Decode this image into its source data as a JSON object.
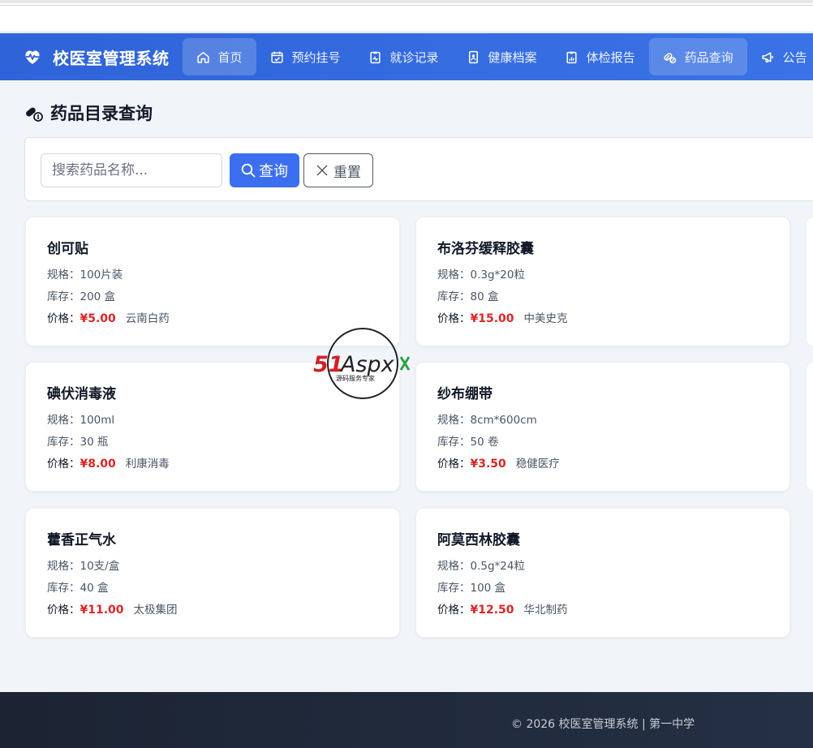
{
  "app": {
    "brand": "校医室管理系统"
  },
  "nav": {
    "items": [
      {
        "label": "首页",
        "icon": "home-icon",
        "active": true
      },
      {
        "label": "预约挂号",
        "icon": "calendar-check-icon",
        "active": false
      },
      {
        "label": "就诊记录",
        "icon": "clipboard-pulse-icon",
        "active": false
      },
      {
        "label": "健康档案",
        "icon": "file-person-icon",
        "active": false
      },
      {
        "label": "体检报告",
        "icon": "clipboard-chart-icon",
        "active": false
      },
      {
        "label": "药品查询",
        "icon": "capsule-icon",
        "active": true
      },
      {
        "label": "公告",
        "icon": "megaphone-icon",
        "active": false
      }
    ]
  },
  "page": {
    "title": "药品目录查询"
  },
  "search": {
    "placeholder": "搜索药品名称...",
    "query_label": "查询",
    "reset_label": "重置"
  },
  "labels": {
    "spec": "规格：",
    "stock": "库存：",
    "price": "价格："
  },
  "medicines": [
    {
      "name": "创可贴",
      "spec": "100片装",
      "stock": "200 盒",
      "price": "¥5.00",
      "maker": "云南白药"
    },
    {
      "name": "布洛芬缓释胶囊",
      "spec": "0.3g*20粒",
      "stock": "80 盒",
      "price": "¥15.00",
      "maker": "中美史克"
    },
    {
      "name": "碘伏消毒液",
      "spec": "100ml",
      "stock": "30 瓶",
      "price": "¥8.00",
      "maker": "利康消毒"
    },
    {
      "name": "纱布绷带",
      "spec": "8cm*600cm",
      "stock": "50 卷",
      "price": "¥3.50",
      "maker": "稳健医疗"
    },
    {
      "name": "藿香正气水",
      "spec": "10支/盒",
      "stock": "40 盒",
      "price": "¥11.00",
      "maker": "太极集团"
    },
    {
      "name": "阿莫西林胶囊",
      "spec": "0.5g*24粒",
      "stock": "100 盒",
      "price": "¥12.50",
      "maker": "华北制药"
    }
  ],
  "watermark": {
    "logo_text": "51Aspx",
    "tagline": "源码服务专家"
  },
  "footer": {
    "text": "© 2026 校医室管理系统 | 第一中学"
  },
  "colors": {
    "nav_bg": "#2f63d9",
    "primary_button": "#3b6ff0",
    "price": "#dc2626",
    "footer_bg": "#1c2433"
  }
}
